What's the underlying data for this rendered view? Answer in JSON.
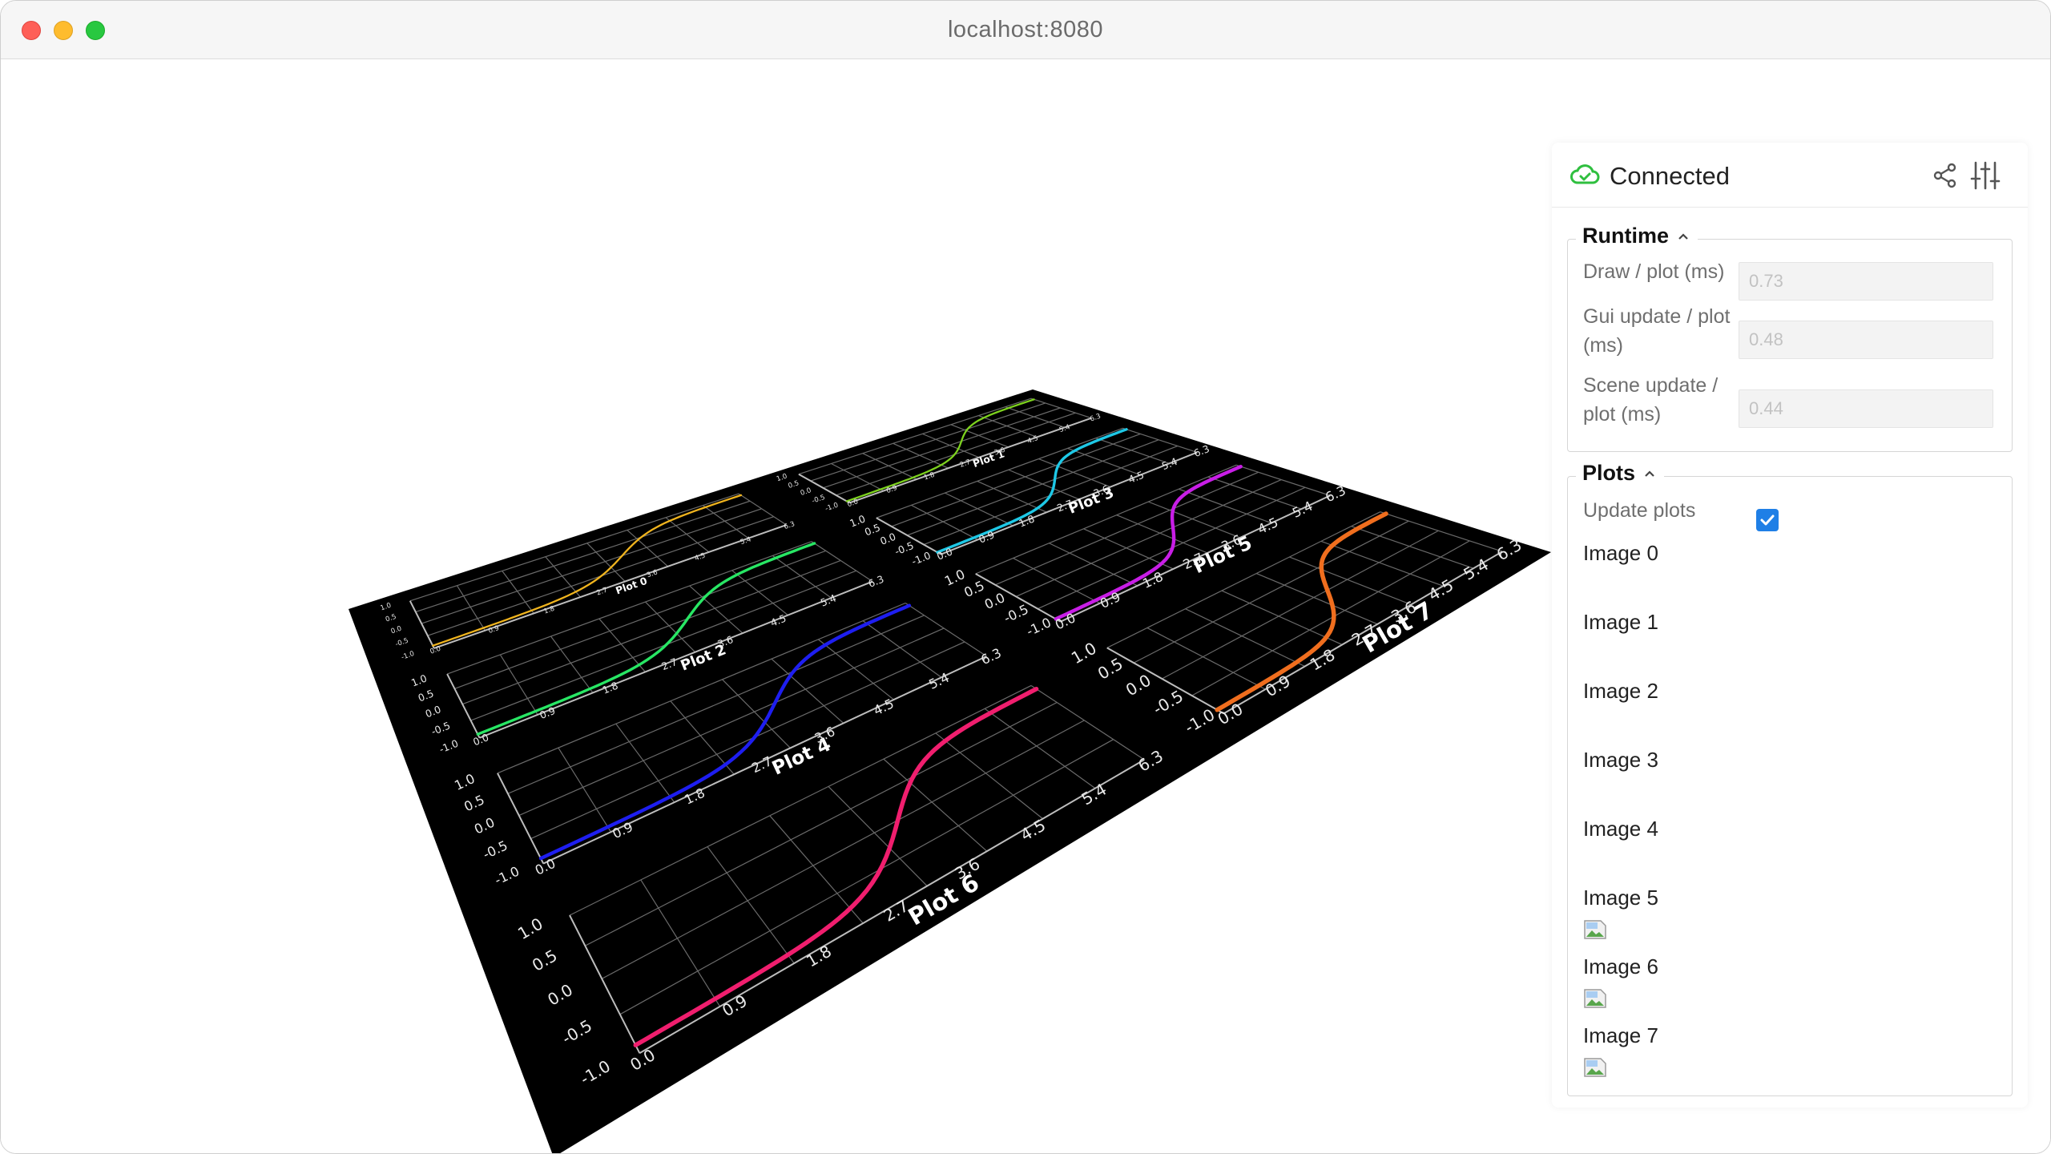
{
  "window": {
    "title": "localhost:8080"
  },
  "status": {
    "text": "Connected",
    "color": "#2fbf3f"
  },
  "header_icons": [
    "share-icon",
    "sliders-icon"
  ],
  "runtime": {
    "title": "Runtime",
    "rows": [
      {
        "label": "Draw / plot (ms)",
        "value": "0.73"
      },
      {
        "label": "Gui update / plot (ms)",
        "value": "0.48"
      },
      {
        "label": "Scene update / plot (ms)",
        "value": "0.44"
      }
    ]
  },
  "plots_folder": {
    "title": "Plots",
    "update_label": "Update plots",
    "update_checked": true,
    "images": [
      "Image 0",
      "Image 1",
      "Image 2",
      "Image 3",
      "Image 4",
      "Image 5",
      "Image 6",
      "Image 7"
    ]
  },
  "scene": {
    "plots": [
      {
        "title": "Plot 0",
        "color": "#f0b41e"
      },
      {
        "title": "Plot 1",
        "color": "#7dd21e"
      },
      {
        "title": "Plot 2",
        "color": "#28e664"
      },
      {
        "title": "Plot 3",
        "color": "#1ec8e6"
      },
      {
        "title": "Plot 4",
        "color": "#1e1ef0"
      },
      {
        "title": "Plot 5",
        "color": "#c81ee6"
      },
      {
        "title": "Plot 6",
        "color": "#f01e6e"
      },
      {
        "title": "Plot 7",
        "color": "#f06e1e"
      }
    ],
    "y_ticks": [
      "1.0",
      "0.5",
      "0.0",
      "-0.5",
      "-1.0"
    ],
    "x_ticks": [
      "0.0",
      "0.9",
      "1.8",
      "2.7",
      "3.6",
      "4.5",
      "5.4",
      "6.3"
    ]
  }
}
